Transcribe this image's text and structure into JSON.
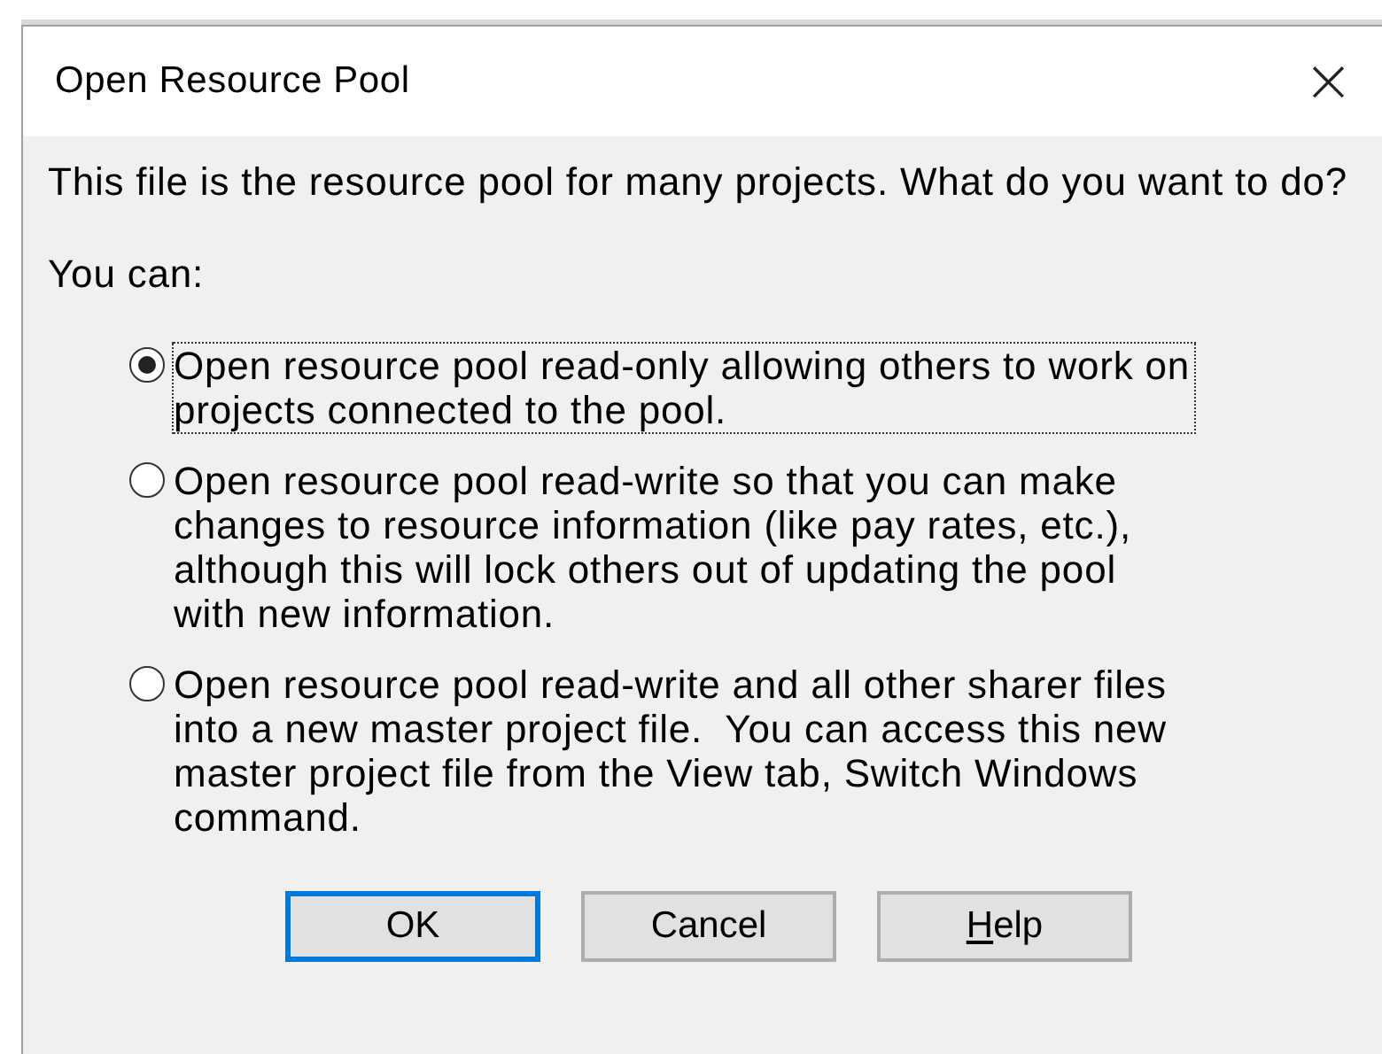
{
  "window": {
    "title": "Open Resource Pool",
    "close": "×"
  },
  "prompt": "This file is the resource pool for many projects. What do you want to do?",
  "options_label": "You can:",
  "options": [
    {
      "label": "Open resource pool read-only allowing others to work on\nprojects connected to the pool.",
      "selected": true,
      "focused": true
    },
    {
      "label": "Open resource pool read-write so that you can make\nchanges to resource information (like pay rates, etc.),\nalthough this will lock others out of updating the pool\nwith new information.",
      "selected": false,
      "focused": false
    },
    {
      "label": "Open resource pool read-write and all other sharer files\ninto a new master project file.  You can access this new\nmaster project file from the View tab, Switch Windows\ncommand.",
      "selected": false,
      "focused": false
    }
  ],
  "buttons": [
    {
      "label": "OK",
      "default": true
    },
    {
      "label": "Cancel",
      "default": false
    },
    {
      "label_parts": [
        {
          "text": "H",
          "underlined": true
        },
        {
          "text": "elp",
          "underlined": false
        }
      ],
      "default": false
    }
  ]
}
